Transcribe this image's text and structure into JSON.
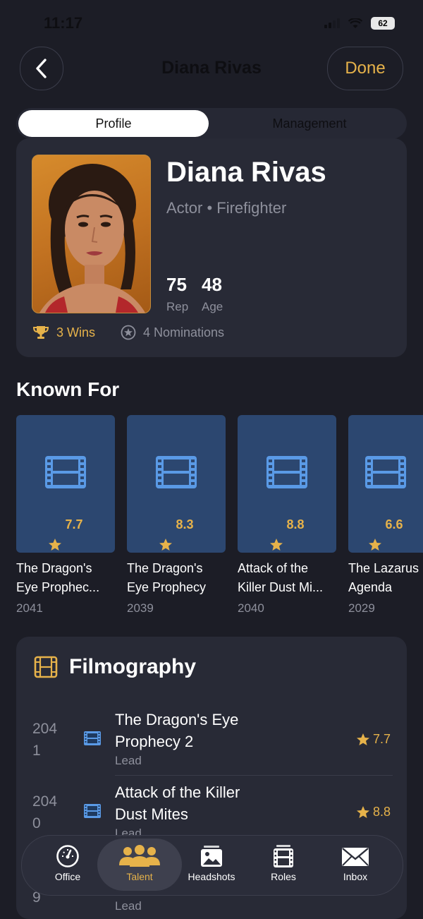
{
  "status_bar": {
    "time": "11:17",
    "battery": "62"
  },
  "nav": {
    "title": "Diana Rivas",
    "done_label": "Done"
  },
  "segments": {
    "active": "Profile",
    "inactive": "Management"
  },
  "profile": {
    "name": "Diana Rivas",
    "roles": "Actor • Firefighter",
    "rep_value": "75",
    "rep_label": "Rep",
    "age_value": "48",
    "age_label": "Age",
    "wins": "3 Wins",
    "nominations": "4 Nominations"
  },
  "known_for": {
    "title": "Known For",
    "items": [
      {
        "rating": "7.7",
        "title_line1": "The Dragon's",
        "title_line2": "Eye Prophec...",
        "year": "2041"
      },
      {
        "rating": "8.3",
        "title_line1": "The Dragon's",
        "title_line2": "Eye Prophecy",
        "year": "2039"
      },
      {
        "rating": "8.8",
        "title_line1": "Attack of the",
        "title_line2": "Killer Dust Mi...",
        "year": "2040"
      },
      {
        "rating": "6.6",
        "title_line1": "The Lazarus",
        "title_line2": "Agenda",
        "year": "2029"
      }
    ]
  },
  "filmography": {
    "title": "Filmography",
    "rows": [
      {
        "year_line1": "204",
        "year_line2": "1",
        "title_line1": "The Dragon's Eye",
        "title_line2": "Prophecy 2",
        "role": "Lead",
        "rating": "7.7"
      },
      {
        "year_line1": "204",
        "year_line2": "0",
        "title_line1": "Attack of the Killer",
        "title_line2": "Dust Mites",
        "role": "Lead",
        "rating": "8.8"
      }
    ],
    "partial_row": {
      "year_line2": "9",
      "role": "Lead"
    }
  },
  "tabs": [
    {
      "label": "Office",
      "icon": "gauge-icon"
    },
    {
      "label": "Talent",
      "icon": "people-icon",
      "active": true
    },
    {
      "label": "Headshots",
      "icon": "photo-icon"
    },
    {
      "label": "Roles",
      "icon": "film-icon"
    },
    {
      "label": "Inbox",
      "icon": "envelope-icon"
    }
  ],
  "colors": {
    "accent": "#e6b24a",
    "background": "#1c1d26",
    "card": "#282a36",
    "tile": "#2c4770",
    "film_blue": "#5a9ae6"
  }
}
